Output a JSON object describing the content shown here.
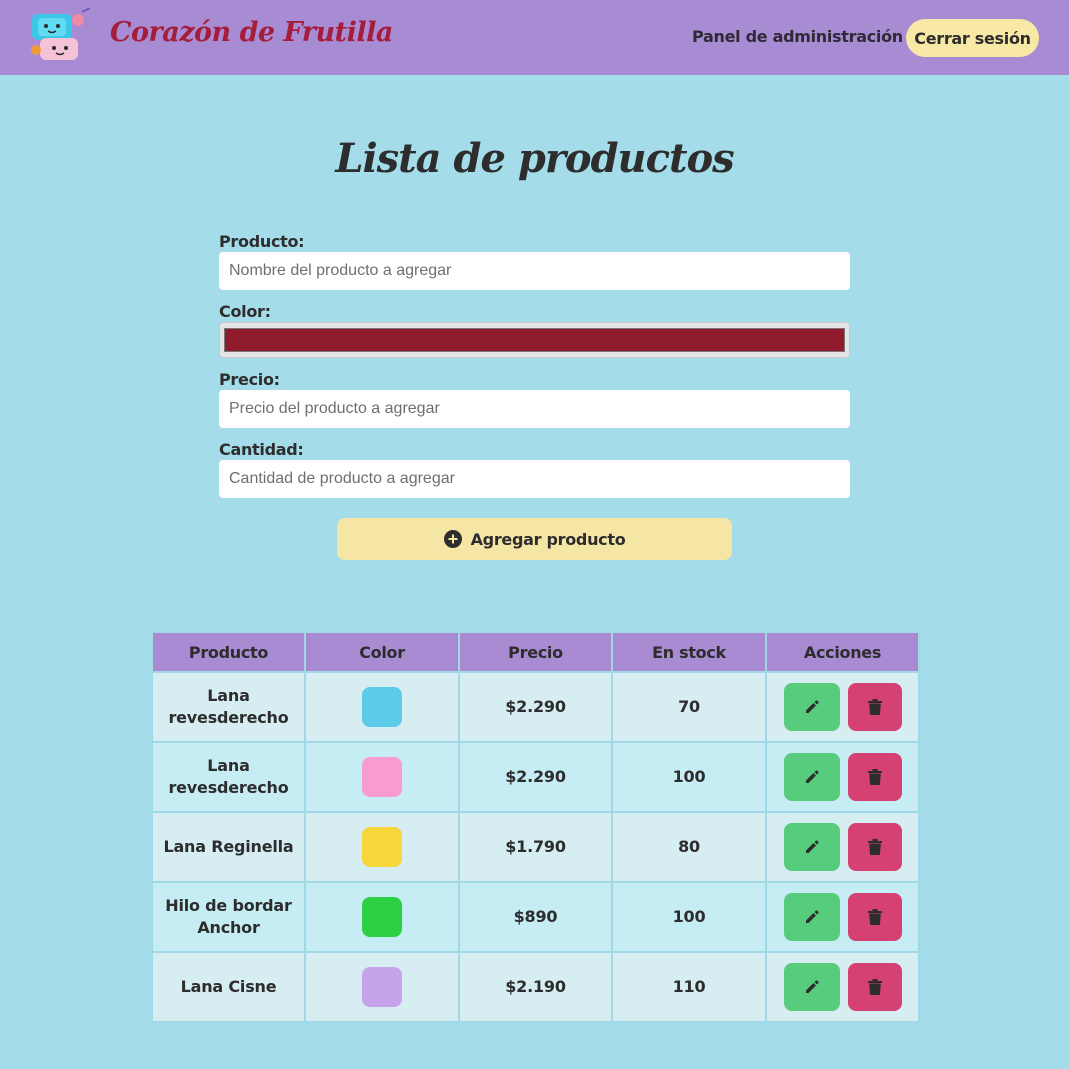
{
  "header": {
    "brand": "Corazón de Frutilla",
    "admin_link": "Panel de administración",
    "logout": "Cerrar sesión"
  },
  "page_title": "Lista de productos",
  "form": {
    "product_label": "Producto:",
    "product_placeholder": "Nombre del producto a agregar",
    "color_label": "Color:",
    "color_value": "#8f1b2c",
    "price_label": "Precio:",
    "price_placeholder": "Precio del producto a agregar",
    "quantity_label": "Cantidad:",
    "quantity_placeholder": "Cantidad de producto a agregar",
    "submit_label": "Agregar producto",
    "submit_icon": "plus-circle-icon"
  },
  "table": {
    "headers": [
      "Producto",
      "Color",
      "Precio",
      "En stock",
      "Acciones"
    ],
    "rows": [
      {
        "product": "Lana revesderecho",
        "color": "#5ccbe9",
        "price": "$2.290",
        "stock": "70"
      },
      {
        "product": "Lana revesderecho",
        "color": "#f79bd1",
        "price": "$2.290",
        "stock": "100"
      },
      {
        "product": "Lana Reginella",
        "color": "#f6d63b",
        "price": "$1.790",
        "stock": "80"
      },
      {
        "product": "Hilo de bordar Anchor",
        "color": "#2cd042",
        "price": "$890",
        "stock": "100"
      },
      {
        "product": "Lana Cisne",
        "color": "#c6a3ea",
        "price": "$2.190",
        "stock": "110"
      }
    ],
    "edit_icon": "pencil-icon",
    "delete_icon": "trash-icon"
  },
  "colors": {
    "header_bg": "#a78bd3",
    "page_bg": "#a4dce9",
    "brand": "#a51d3a",
    "button_yellow": "#f6e6a6",
    "edit_green": "#56cc7c",
    "delete_red": "#d54173"
  }
}
